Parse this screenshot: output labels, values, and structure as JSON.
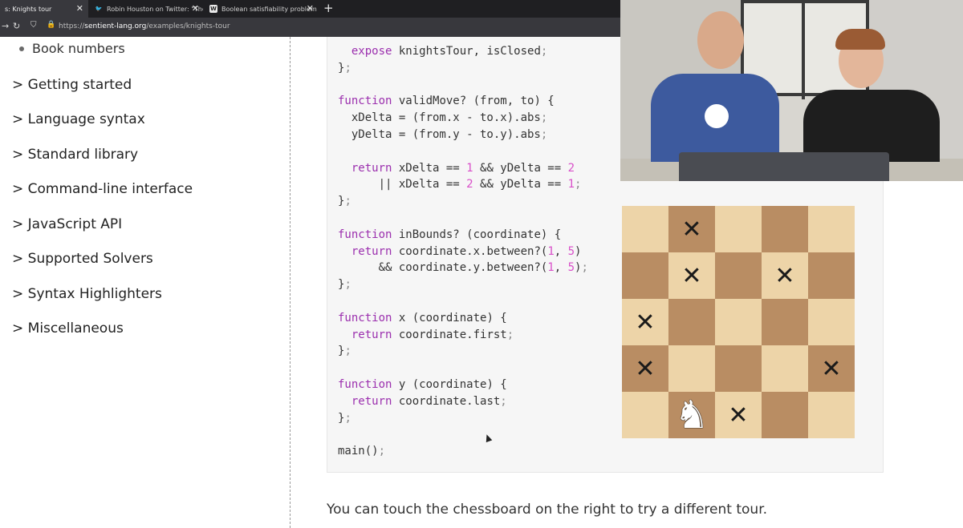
{
  "browser": {
    "tabs": [
      {
        "title": "s: Knights tour",
        "favicon": "sentient-icon",
        "active": true
      },
      {
        "title": "Robin Houston on Twitter: \"The",
        "favicon": "twitter-bird-icon",
        "active": false
      },
      {
        "title": "Boolean satisfiability problem",
        "favicon": "wikipedia-icon",
        "active": false
      }
    ],
    "new_tab_label": "+",
    "url_prefix": "https://",
    "url_host": "sentient-lang.org",
    "url_path": "/examples/knights-tour"
  },
  "sidebar": {
    "sub_item": "Book numbers",
    "items": [
      "> Getting started",
      "> Language syntax",
      "> Standard library",
      "> Command-line interface",
      "> JavaScript API",
      "> Supported Solvers",
      "> Syntax Highlighters",
      "> Miscellaneous"
    ]
  },
  "code": {
    "lines": [
      "  expose knightsTour, isClosed;",
      "};",
      "",
      "function validMove? (from, to) {",
      "  xDelta = (from.x - to.x).abs;",
      "  yDelta = (from.y - to.y).abs;",
      "",
      "  return xDelta == 1 && yDelta == 2",
      "      || xDelta == 2 && yDelta == 1;",
      "};",
      "",
      "function inBounds? (coordinate) {",
      "  return coordinate.x.between?(1, 5)",
      "      && coordinate.y.between?(1, 5);",
      "};",
      "",
      "function x (coordinate) {",
      "  return coordinate.first;",
      "};",
      "",
      "function y (coordinate) {",
      "  return coordinate.last;",
      "};",
      "",
      "main();"
    ]
  },
  "board": {
    "size": 5,
    "light_color": "#edd4a8",
    "dark_color": "#b98d63",
    "mark_symbol": "✕",
    "knight_symbol": "♞",
    "squares": [
      [
        "",
        "x",
        "",
        "",
        ""
      ],
      [
        "",
        "x",
        "",
        "x",
        ""
      ],
      [
        "x",
        "",
        "",
        "",
        ""
      ],
      [
        "x",
        "",
        "",
        "",
        "x"
      ],
      [
        "",
        "knight",
        "x",
        "",
        ""
      ]
    ]
  },
  "footer": {
    "text": "You can touch the chessboard on the right to try a different tour."
  },
  "colors": {
    "keyword": "#9b2fae",
    "number": "#d94fc9",
    "code_bg": "#f6f6f6"
  }
}
